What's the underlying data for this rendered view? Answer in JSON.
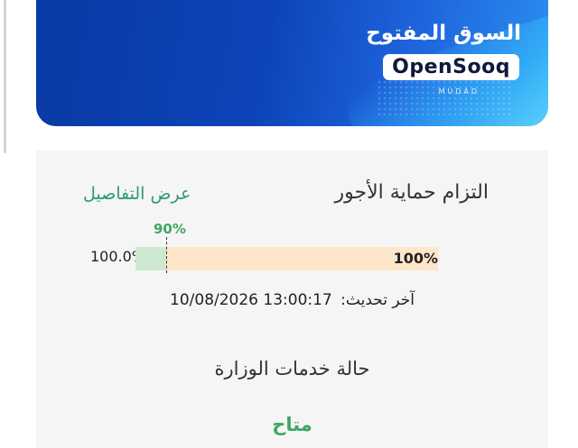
{
  "banner": {
    "logo_arabic": "السوق المفتوح",
    "logo_latin": "OpenSooq",
    "sub_brand": "MUDAD"
  },
  "wage_protection": {
    "title": "التزام حماية الأجور",
    "details_link": "عرض التفاصيل",
    "target_label": "90%",
    "target_percent": 90,
    "current_percent": 100,
    "bar_left_label": "100.0%",
    "bar_value_label": "100%",
    "last_updated_label": "آخر تحديث:",
    "last_updated_value": "10/08/2026 13:00:17"
  },
  "ministry_services": {
    "title": "حالة خدمات الوزارة",
    "status": "متاح"
  },
  "colors": {
    "banner_blue": "#0c44b8",
    "bar_track": "#fde6c9",
    "bar_fill": "#cfe8d2",
    "accent_green": "#3fa664"
  }
}
